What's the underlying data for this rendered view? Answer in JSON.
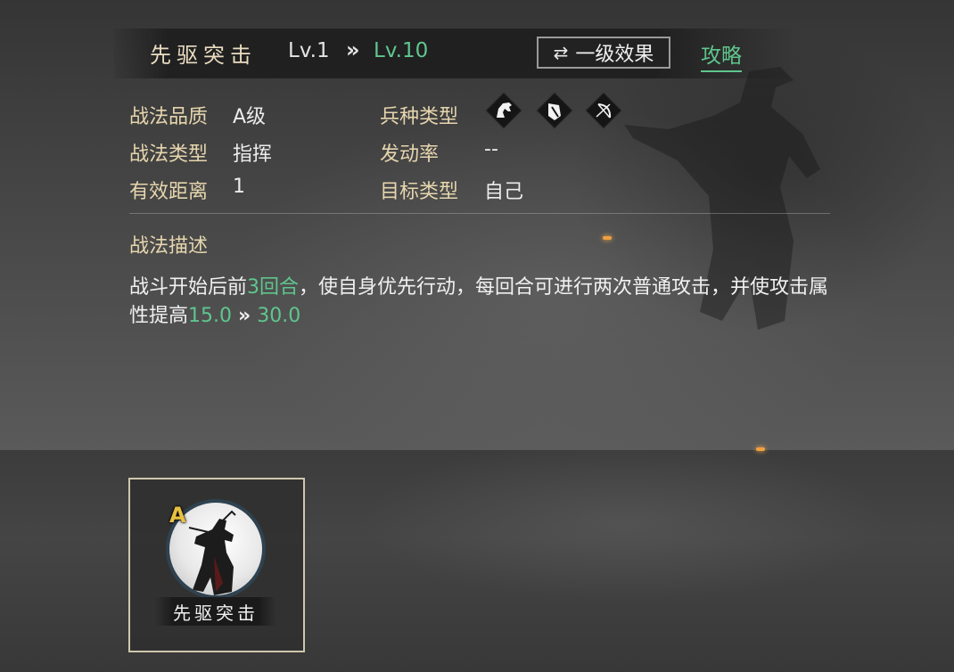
{
  "header": {
    "skill_name": "先驱突击",
    "level_current": "Lv.1",
    "level_arrow": "»",
    "level_max": "Lv.10",
    "effect_button_icon": "swap-arrows-icon",
    "effect_button_label": "一级效果",
    "guide_link": "攻略"
  },
  "info": {
    "quality_label": "战法品质",
    "quality_value": "A级",
    "type_label": "战法类型",
    "type_value": "指挥",
    "range_label": "有效距离",
    "range_value": "1",
    "troop_label": "兵种类型",
    "troop_icons": [
      "cavalry-horse-icon",
      "shield-infantry-icon",
      "archer-bow-icon"
    ],
    "trigger_label": "发动率",
    "trigger_value": "--",
    "target_label": "目标类型",
    "target_value": "自己"
  },
  "description": {
    "title": "战法描述",
    "text_1": "战斗开始后前",
    "hl_1": "3回合",
    "text_2": "，使自身优先行动，每回合可进行两次普通攻击，并使攻击属性提高",
    "hl_2": "15.0",
    "arrow": "»",
    "hl_3": "30.0"
  },
  "card": {
    "grade": "A",
    "name": "先驱突击"
  },
  "colors": {
    "accent_green": "#5fc68d",
    "label_gold": "#e6d6ae",
    "grade_yellow": "#e8c040"
  }
}
